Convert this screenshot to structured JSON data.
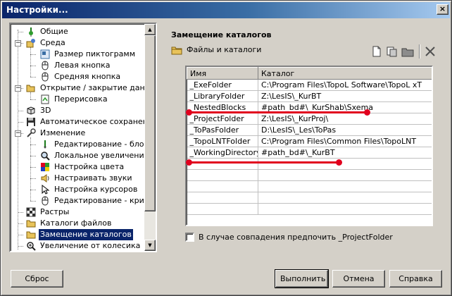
{
  "window": {
    "title": "Настройки...",
    "close": "×"
  },
  "tree": {
    "items": [
      {
        "label": "Общие",
        "icon": "pin-icon"
      },
      {
        "label": "Среда",
        "icon": "environment-icon"
      },
      {
        "label": "Размер пиктограмм",
        "icon": "icon-size-icon"
      },
      {
        "label": "Левая кнопка",
        "icon": "mouse-icon"
      },
      {
        "label": "Средняя кнопка",
        "icon": "mouse-icon"
      },
      {
        "label": "Открытие / закрытие данны",
        "icon": "open-folder-icon"
      },
      {
        "label": "Перерисовка",
        "icon": "redraw-icon"
      },
      {
        "label": "3D",
        "icon": "cube-icon"
      },
      {
        "label": "Автоматическое сохранение",
        "icon": "floppy-disk-icon"
      },
      {
        "label": "Изменение",
        "icon": "wrench-icon"
      },
      {
        "label": "Редактирование - блоки",
        "icon": "pencil-icon"
      },
      {
        "label": "Локальное увеличение -",
        "icon": "magnifier-icon"
      },
      {
        "label": "Настройка цвета",
        "icon": "color-grid-icon"
      },
      {
        "label": "Настраивать звуки",
        "icon": "speaker-icon"
      },
      {
        "label": "Настройка курсоров",
        "icon": "cursor-icon"
      },
      {
        "label": "Редактирование - кривая",
        "icon": "mouse-icon"
      },
      {
        "label": "Растры",
        "icon": "checkered-icon"
      },
      {
        "label": "Каталоги файлов",
        "icon": "folder-icon"
      },
      {
        "label": "Замещение каталогов",
        "icon": "folder-icon"
      },
      {
        "label": "Увеличение от колесика",
        "icon": "zoom-icon"
      }
    ]
  },
  "panel": {
    "title": "Замещение каталогов",
    "group_label": "Файлы и каталоги",
    "toolbar_icons": [
      "new-icon",
      "copy-icon",
      "folder-icon",
      "delete-icon"
    ]
  },
  "grid": {
    "columns": [
      "Имя",
      "Каталог"
    ],
    "rows": [
      {
        "name": "_ExeFolder",
        "path": "C:\\Program Files\\TopoL Software\\TopoL xT"
      },
      {
        "name": "_LibraryFolder",
        "path": "Z:\\LesIS\\_KurBT"
      },
      {
        "name": "_NestedBlocks",
        "path": "#path_bd#\\_KurShab\\Sxema"
      },
      {
        "name": "_ProjectFolder",
        "path": "Z:\\LesIS\\_KurProj\\"
      },
      {
        "name": "_ToPasFolder",
        "path": "D:\\LesIS\\_Les\\ToPas"
      },
      {
        "name": "_TopoLNTFolder",
        "path": "C:\\Program Files\\Common Files\\TopoLNT"
      },
      {
        "name": "_WorkingDirectory",
        "path": "#path_bd#\\_KurBT"
      }
    ],
    "highlight_color": "#e1001e"
  },
  "checkbox": {
    "label": "В случае совпадения предпочить _ProjectFolder"
  },
  "buttons": {
    "reset": "Сброс",
    "apply": "Выполнить",
    "cancel": "Отмена",
    "help": "Справка"
  }
}
